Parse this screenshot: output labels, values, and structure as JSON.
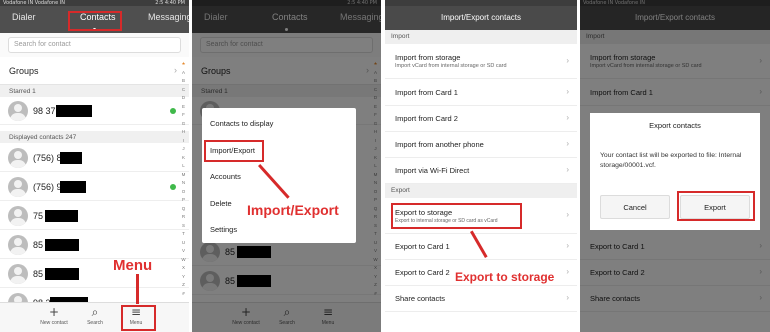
{
  "statusbar": {
    "carrier_p1": "Vodafone IN Vodafone IN",
    "carrier_p4": "Vodafone IN Vodafone IN",
    "clock_p1": "2:5 4:40 PM",
    "clock_p2": "2:5 4:40 PM"
  },
  "contacts_screen": {
    "tabs": [
      "Dialer",
      "Contacts",
      "Messaging"
    ],
    "search_placeholder": "Search for contact",
    "groups_label": "Groups",
    "starred_label": "Starred 1",
    "displayed_label": "Displayed contacts 247",
    "contacts": [
      "98 37",
      "(756) 8",
      "(756) 9",
      "75",
      "85",
      "85",
      "98 3"
    ],
    "alphabet": [
      "★",
      "A",
      "B",
      "C",
      "D",
      "E",
      "F",
      "G",
      "H",
      "I",
      "J",
      "K",
      "L",
      "M",
      "N",
      "O",
      "P",
      "Q",
      "R",
      "S",
      "T",
      "U",
      "V",
      "W",
      "X",
      "Y",
      "Z",
      "#"
    ],
    "bottom_bar": {
      "new_contact": "New contact",
      "search": "Search",
      "menu": "Menu"
    }
  },
  "popup_menu": {
    "items": [
      "Contacts to display",
      "Import/Export",
      "Accounts",
      "Delete",
      "Settings"
    ]
  },
  "import_export": {
    "title": "Import/Export contacts",
    "import_section": "Import",
    "import_items": [
      {
        "title": "Import from storage",
        "subtitle": "Import vCard from internal storage or SD card"
      },
      {
        "title": "Import from Card 1",
        "subtitle": ""
      },
      {
        "title": "Import from Card 2",
        "subtitle": ""
      },
      {
        "title": "Import from another phone",
        "subtitle": ""
      },
      {
        "title": "Import via Wi-Fi Direct",
        "subtitle": ""
      }
    ],
    "export_section": "Export",
    "export_items": [
      {
        "title": "Export to storage",
        "subtitle": "Export to internal storage or SD card as vCard"
      },
      {
        "title": "Export to Card 1",
        "subtitle": ""
      },
      {
        "title": "Export to Card 2",
        "subtitle": ""
      },
      {
        "title": "Share contacts",
        "subtitle": ""
      }
    ]
  },
  "export_dialog": {
    "title": "Export contacts",
    "message": "Your contact list will be exported to file: Internal storage/00001.vcf.",
    "cancel_label": "Cancel",
    "export_label": "Export"
  },
  "annotations": {
    "menu": "Menu",
    "import_export": "Import/Export",
    "export_to_storage": "Export to storage",
    "color": "#e03030"
  }
}
